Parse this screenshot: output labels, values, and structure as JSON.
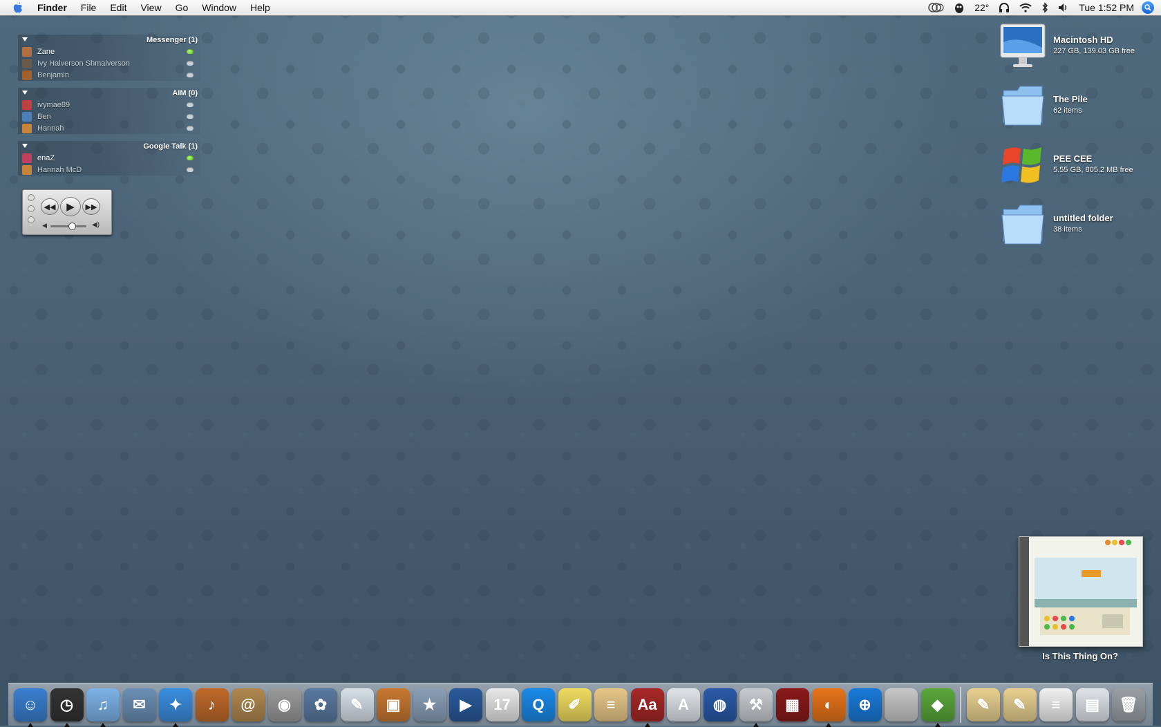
{
  "menubar": {
    "app_name": "Finder",
    "menus": [
      "File",
      "Edit",
      "View",
      "Go",
      "Window",
      "Help"
    ],
    "status": {
      "temperature": "22°",
      "clock": "Tue 1:52 PM"
    }
  },
  "buddy_list": {
    "groups": [
      {
        "title": "Messenger (1)",
        "buddies": [
          {
            "name": "Zane",
            "online": true,
            "avatar_color": "#b07040"
          },
          {
            "name": "Ivy Halverson Shmalverson",
            "online": false,
            "avatar_color": "#6a5a4a"
          },
          {
            "name": "Benjamin",
            "online": false,
            "avatar_color": "#a0602a"
          }
        ]
      },
      {
        "title": "AIM (0)",
        "buddies": [
          {
            "name": "ivymae89",
            "online": false,
            "avatar_color": "#c04040"
          },
          {
            "name": "Ben",
            "online": false,
            "avatar_color": "#4a7fb8"
          },
          {
            "name": "Hannah",
            "online": false,
            "avatar_color": "#c8843a"
          }
        ]
      },
      {
        "title": "Google Talk (1)",
        "buddies": [
          {
            "name": "enaZ",
            "online": true,
            "avatar_color": "#c04060"
          },
          {
            "name": "Hannah McD",
            "online": false,
            "avatar_color": "#c8843a"
          }
        ]
      }
    ]
  },
  "itunes_controller": {
    "volume": 0.6
  },
  "desktop_icons": [
    {
      "title": "Macintosh HD",
      "subtitle": "227 GB, 139.03 GB free",
      "icon": "imac-icon"
    },
    {
      "title": "The Pile",
      "subtitle": "62 items",
      "icon": "folder-icon"
    },
    {
      "title": "PEE CEE",
      "subtitle": "5.55 GB, 805.2 MB free",
      "icon": "windows-drive-icon"
    },
    {
      "title": "untitled folder",
      "subtitle": "38 items",
      "icon": "folder-icon"
    }
  ],
  "album": {
    "caption": "Is This Thing On?"
  },
  "dock": {
    "apps": [
      {
        "name": "finder-icon",
        "color": "#3a7fd0",
        "glyph": "☺",
        "running": true
      },
      {
        "name": "dashboard-icon",
        "color": "#333333",
        "glyph": "◷",
        "running": true
      },
      {
        "name": "itunes-icon",
        "color": "#7db3e8",
        "glyph": "♫",
        "running": true
      },
      {
        "name": "mail-icon",
        "color": "#6b8fb5",
        "glyph": "✉",
        "running": false
      },
      {
        "name": "safari-icon",
        "color": "#3b8ee0",
        "glyph": "✦",
        "running": true
      },
      {
        "name": "garageband-icon",
        "color": "#c06a2a",
        "glyph": "♪",
        "running": false
      },
      {
        "name": "address-book-icon",
        "color": "#b08850",
        "glyph": "@",
        "running": false
      },
      {
        "name": "camera-icon",
        "color": "#9a9a9a",
        "glyph": "◉",
        "running": false
      },
      {
        "name": "iphoto-icon",
        "color": "#5a7aa0",
        "glyph": "✿",
        "running": false
      },
      {
        "name": "pages-icon",
        "color": "#d8e0e8",
        "glyph": "✎",
        "running": false
      },
      {
        "name": "preview-icon",
        "color": "#c87830",
        "glyph": "▣",
        "running": false
      },
      {
        "name": "imovie-icon",
        "color": "#8aa0b8",
        "glyph": "★",
        "running": false
      },
      {
        "name": "clapper-icon",
        "color": "#2a5a9a",
        "glyph": "▶",
        "running": false
      },
      {
        "name": "ical-icon",
        "color": "#e8e8e8",
        "glyph": "17",
        "running": false
      },
      {
        "name": "quicktime-icon",
        "color": "#1a8ae8",
        "glyph": "Q",
        "running": false
      },
      {
        "name": "stickies-icon",
        "color": "#f0dc60",
        "glyph": "✐",
        "running": false
      },
      {
        "name": "notepad-icon",
        "color": "#e8c888",
        "glyph": "≡",
        "running": false
      },
      {
        "name": "dictionary-icon",
        "color": "#a82828",
        "glyph": "Aa",
        "running": true
      },
      {
        "name": "textedit-icon",
        "color": "#e0e4e8",
        "glyph": "A",
        "running": false
      },
      {
        "name": "google-earth-icon",
        "color": "#2a5aa8",
        "glyph": "◍",
        "running": false
      },
      {
        "name": "xcode-icon",
        "color": "#c8ccd0",
        "glyph": "⚒",
        "running": true
      },
      {
        "name": "front-row-icon",
        "color": "#8a1a1a",
        "glyph": "▦",
        "running": false
      },
      {
        "name": "firefox-icon",
        "color": "#e8741a",
        "glyph": "◐",
        "running": true
      },
      {
        "name": "network-icon",
        "color": "#1a7ad8",
        "glyph": "⊕",
        "running": false
      },
      {
        "name": "boot-camp-icon",
        "color": "#c8c8c8",
        "glyph": "",
        "running": false
      },
      {
        "name": "adium-icon",
        "color": "#5aa83a",
        "glyph": "◆",
        "running": true
      }
    ],
    "stacks": [
      {
        "name": "document-stack-icon",
        "color": "#e8d090",
        "glyph": "✎"
      },
      {
        "name": "notes-stack-icon",
        "color": "#e8d090",
        "glyph": "✎"
      },
      {
        "name": "text-document-icon",
        "color": "#f0f0f0",
        "glyph": "≡"
      },
      {
        "name": "web-document-icon",
        "color": "#e0e4ea",
        "glyph": "▤"
      },
      {
        "name": "trash-icon",
        "color": "#9aa0a6",
        "glyph": "🗑"
      }
    ]
  }
}
